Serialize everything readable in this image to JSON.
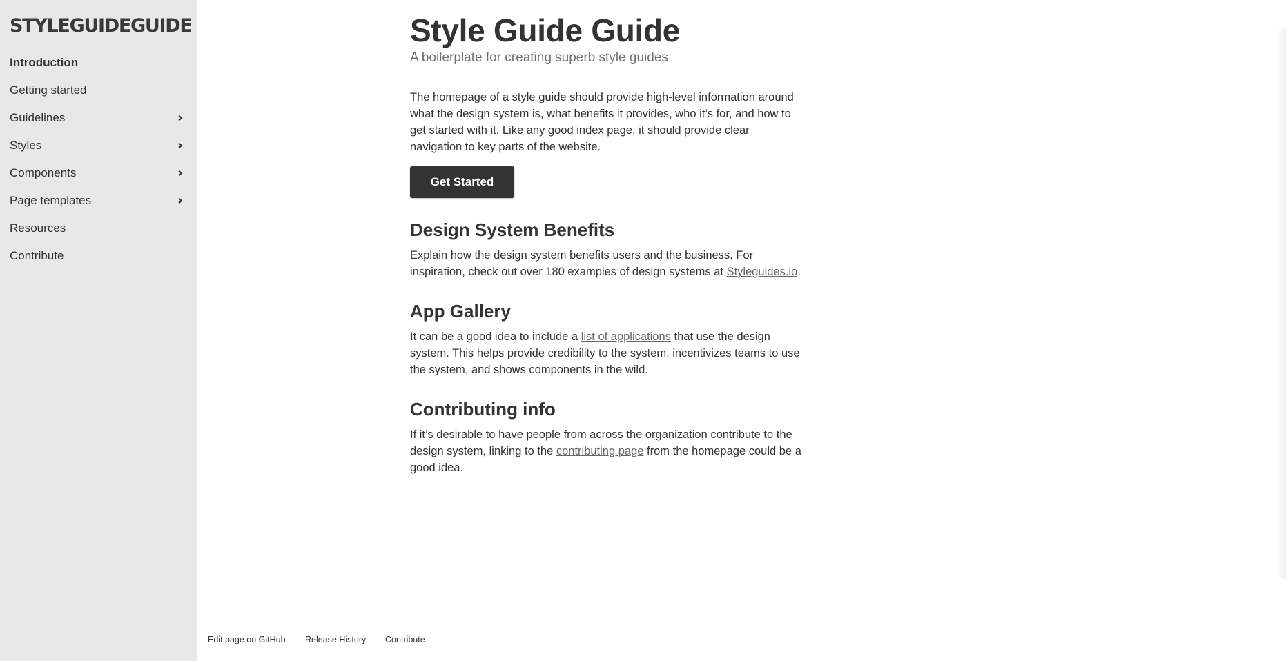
{
  "sidebar": {
    "logo": "STYLEGUIDEGUIDE",
    "items": [
      {
        "label": "Introduction",
        "active": true,
        "has_children": false
      },
      {
        "label": "Getting started",
        "active": false,
        "has_children": false
      },
      {
        "label": "Guidelines",
        "active": false,
        "has_children": true
      },
      {
        "label": "Styles",
        "active": false,
        "has_children": true
      },
      {
        "label": "Components",
        "active": false,
        "has_children": true
      },
      {
        "label": "Page templates",
        "active": false,
        "has_children": true
      },
      {
        "label": "Resources",
        "active": false,
        "has_children": false
      },
      {
        "label": "Contribute",
        "active": false,
        "has_children": false
      }
    ]
  },
  "main": {
    "title": "Style Guide Guide",
    "subtitle": "A boilerplate for creating superb style guides",
    "intro": "The homepage of a style guide should provide high-level information around what the design system is, what benefits it provides, who it’s for, and how to get started with it. Like any good index page, it should provide clear navigation to key parts of the website.",
    "cta_label": "Get Started",
    "benefits": {
      "heading": "Design System Benefits",
      "text_before": "Explain how the design system benefits users and the business. For inspiration, check out over 180 examples of design systems at ",
      "link": "Styleguides.io",
      "text_after": "."
    },
    "gallery": {
      "heading": "App Gallery",
      "text_before": "It can be a good idea to include a ",
      "link": "list of applications",
      "text_after": " that use the design system. This helps provide credibility to the system, incentivizes teams to use the system, and shows components in the wild."
    },
    "contributing": {
      "heading": "Contributing info",
      "text_before": "If it’s desirable to have people from across the organization contribute to the design system, linking to the ",
      "link": "contributing page",
      "text_after": " from the homepage could be a good idea."
    }
  },
  "footer": {
    "links": [
      "Edit page on GitHub",
      "Release History",
      "Contribute"
    ]
  },
  "colors": {
    "sidebar_bg": "#e8e8e8",
    "text": "#333333",
    "muted": "#707070",
    "button_bg": "#333333",
    "button_text": "#ffffff"
  }
}
